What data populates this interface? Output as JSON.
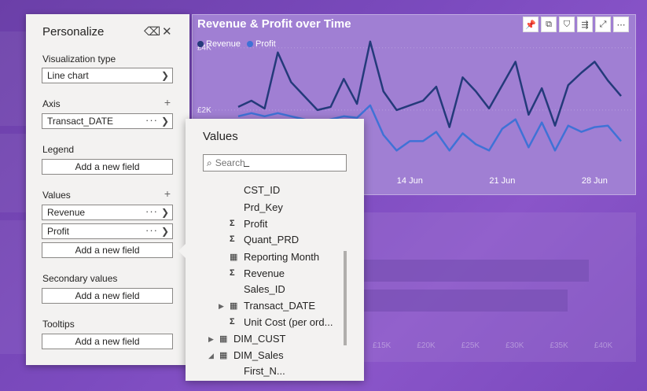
{
  "personalize": {
    "title": "Personalize",
    "sections": {
      "viz_type_label": "Visualization type",
      "viz_type_value": "Line chart",
      "axis_label": "Axis",
      "axis_value": "Transact_DATE",
      "legend_label": "Legend",
      "legend_add": "Add a new field",
      "values_label": "Values",
      "values_items": [
        "Revenue",
        "Profit"
      ],
      "values_add": "Add a new field",
      "secondary_label": "Secondary values",
      "secondary_add": "Add a new field",
      "tooltips_label": "Tooltips",
      "tooltips_add": "Add a new field"
    }
  },
  "values_popup": {
    "title": "Values",
    "search_placeholder": "Search",
    "fields": [
      {
        "label": "–",
        "icon": ""
      },
      {
        "label": "CST_ID",
        "icon": ""
      },
      {
        "label": "Prd_Key",
        "icon": ""
      },
      {
        "label": "Profit",
        "icon": "sigma-icon"
      },
      {
        "label": "Quant_PRD",
        "icon": "sigma-icon"
      },
      {
        "label": "Reporting Month",
        "icon": "calculator-icon"
      },
      {
        "label": "Revenue",
        "icon": "sigma-icon"
      },
      {
        "label": "Sales_ID",
        "icon": ""
      },
      {
        "label": "Transact_DATE",
        "icon": "calendar-icon"
      },
      {
        "label": "Unit Cost (per ord...",
        "icon": "sigma-icon"
      },
      {
        "label": "DIM_CUST",
        "icon": "table-icon"
      },
      {
        "label": "DIM_Sales",
        "icon": "table-icon"
      },
      {
        "label": "First_N...",
        "icon": ""
      }
    ]
  },
  "chart": {
    "title": "Revenue & Profit over Time",
    "toolbar_icons": [
      "pin-icon",
      "copy-icon",
      "filter-icon",
      "drill-icon",
      "expand-icon",
      "more-icon"
    ]
  },
  "chart_data": {
    "type": "line",
    "title": "Revenue & Profit over Time",
    "x_ticks": [
      "14 Jun",
      "21 Jun",
      "28 Jun"
    ],
    "y_ticks": [
      "£2K",
      "£4K"
    ],
    "ylim": [
      0,
      4600
    ],
    "x_start": 0,
    "x_end": 29,
    "x_tick_positions": [
      13,
      20,
      27
    ],
    "colors": {
      "Revenue": "#243a7a",
      "Profit": "#3f72d6"
    },
    "series": [
      {
        "name": "Revenue",
        "values": [
          2100,
          2300,
          2050,
          3850,
          2900,
          2450,
          2000,
          2100,
          3000,
          2200,
          4200,
          2600,
          2000,
          2150,
          2300,
          2750,
          1450,
          3050,
          2600,
          2050,
          2800,
          3550,
          1850,
          2700,
          1500,
          2800,
          3200,
          3550,
          2950,
          2450
        ]
      },
      {
        "name": "Profit",
        "values": [
          1800,
          1900,
          1800,
          1900,
          1800,
          1700,
          1600,
          1700,
          1800,
          1750,
          2150,
          1200,
          700,
          1000,
          1000,
          1300,
          700,
          1250,
          900,
          700,
          1400,
          1700,
          800,
          1600,
          700,
          1500,
          1300,
          1450,
          1500,
          1000
        ]
      }
    ]
  },
  "background": {
    "bar_axis_ticks": [
      "£15K",
      "£20K",
      "£25K",
      "£30K",
      "£35K",
      "£40K"
    ]
  }
}
